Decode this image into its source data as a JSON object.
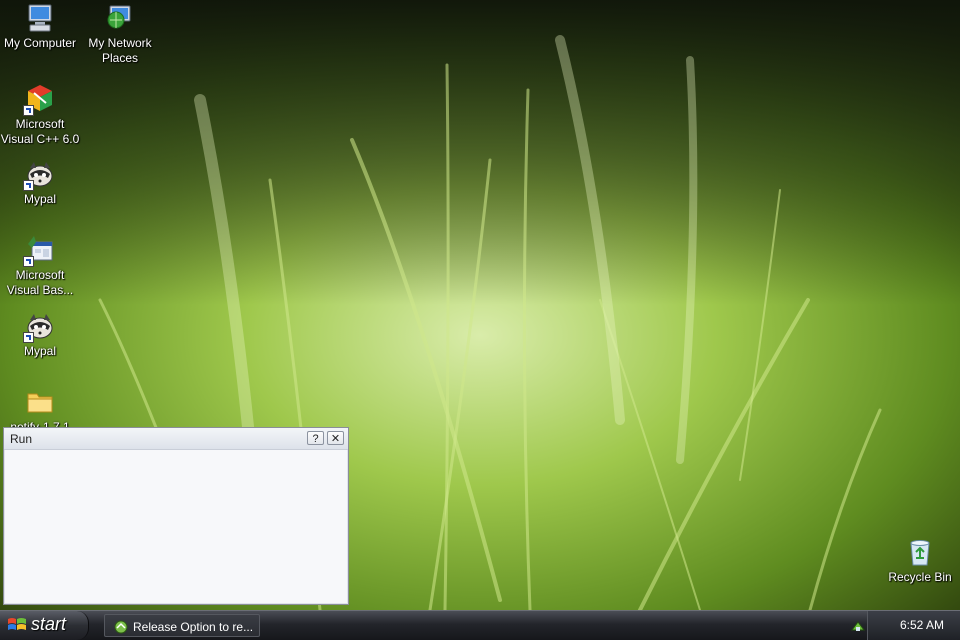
{
  "desktop": {
    "icons": [
      {
        "label": "My Computer",
        "icon": "my-computer-icon"
      },
      {
        "label": "My Network\nPlaces",
        "icon": "network-places-icon"
      },
      {
        "label": "Microsoft\nVisual C++ 6.0",
        "icon": "visual-cpp-icon"
      },
      {
        "label": "Mypal",
        "icon": "mypal-icon"
      },
      {
        "label": "Microsoft\nVisual Bas...",
        "icon": "visual-basic-icon"
      },
      {
        "label": "Mypal",
        "icon": "mypal-icon"
      },
      {
        "label": "notify-1.7.1",
        "icon": "folder-icon"
      },
      {
        "label": "Recycle Bin",
        "icon": "recycle-bin-icon"
      }
    ]
  },
  "run_dialog": {
    "title": "Run",
    "help_label": "?",
    "close_label": "✕"
  },
  "taskbar": {
    "start_label": "start",
    "task_item_label": "Release Option to re...",
    "clock": "6:52 AM"
  },
  "colors": {
    "grass_light": "#b7d96a",
    "grass_dark": "#2f4a10",
    "taskbar": "#23252b"
  }
}
